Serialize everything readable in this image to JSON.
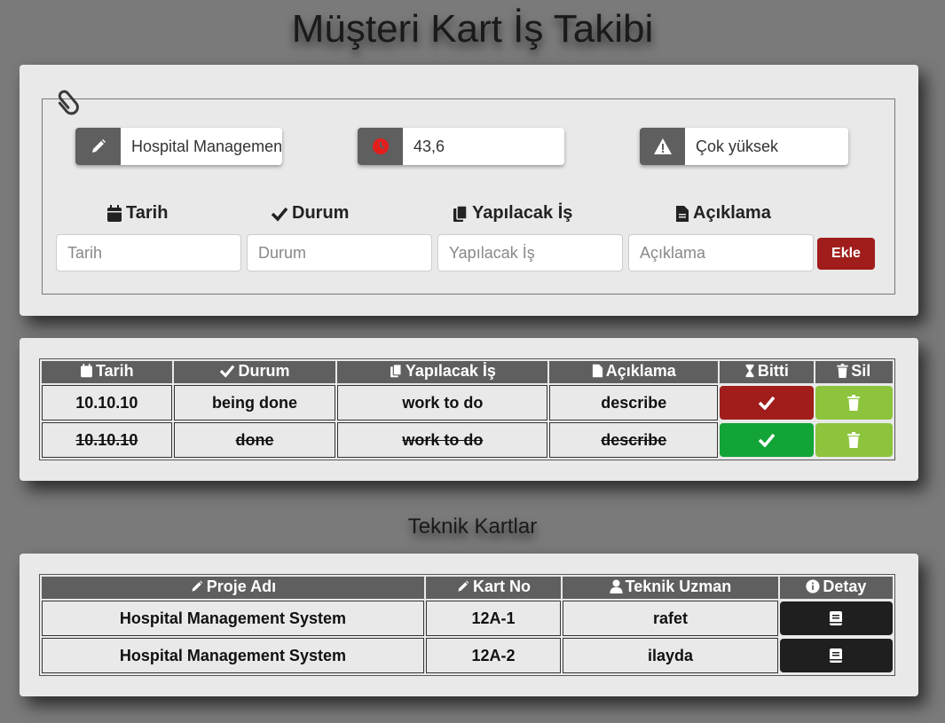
{
  "page_title": "Müşteri Kart İş Takibi",
  "form": {
    "project_value": "Hospital Management System",
    "hours_value": "43,6",
    "priority_value": "Çok yüksek",
    "labels": {
      "tarih": "Tarih",
      "durum": "Durum",
      "yapilacak": "Yapılacak İş",
      "aciklama": "Açıklama"
    },
    "placeholders": {
      "tarih": "Tarih",
      "durum": "Durum",
      "yapilacak": "Yapılacak İş",
      "aciklama": "Açıklama"
    },
    "add_label": "Ekle"
  },
  "tasks": {
    "headers": [
      "Tarih",
      "Durum",
      "Yapılacak İş",
      "Açıklama",
      "Bitti",
      "Sil"
    ],
    "rows": [
      {
        "tarih": "10.10.10",
        "durum": "being done",
        "is": "work to do",
        "aciklama": "describe",
        "done": false
      },
      {
        "tarih": "10.10.10",
        "durum": "done",
        "is": "work to do",
        "aciklama": "describe",
        "done": true
      }
    ]
  },
  "cards_section_title": "Teknik Kartlar",
  "cards": {
    "headers": [
      "Proje Adı",
      "Kart No",
      "Teknik Uzman",
      "Detay"
    ],
    "rows": [
      {
        "proje": "Hospital Management System",
        "kart_no": "12A-1",
        "uzman": "rafet"
      },
      {
        "proje": "Hospital Management System",
        "kart_no": "12A-2",
        "uzman": "ilayda"
      }
    ]
  },
  "colors": {
    "accent_red": "#a01d1b",
    "done_green": "#13a437",
    "delete_lime": "#8cc43d",
    "detail_dark": "#1f1f1f",
    "header_gray": "#5f5f5f"
  },
  "icons": {
    "project": "pencil-icon",
    "hours": "clock-icon",
    "priority": "warning-icon",
    "fieldset": "paperclip-icon"
  }
}
